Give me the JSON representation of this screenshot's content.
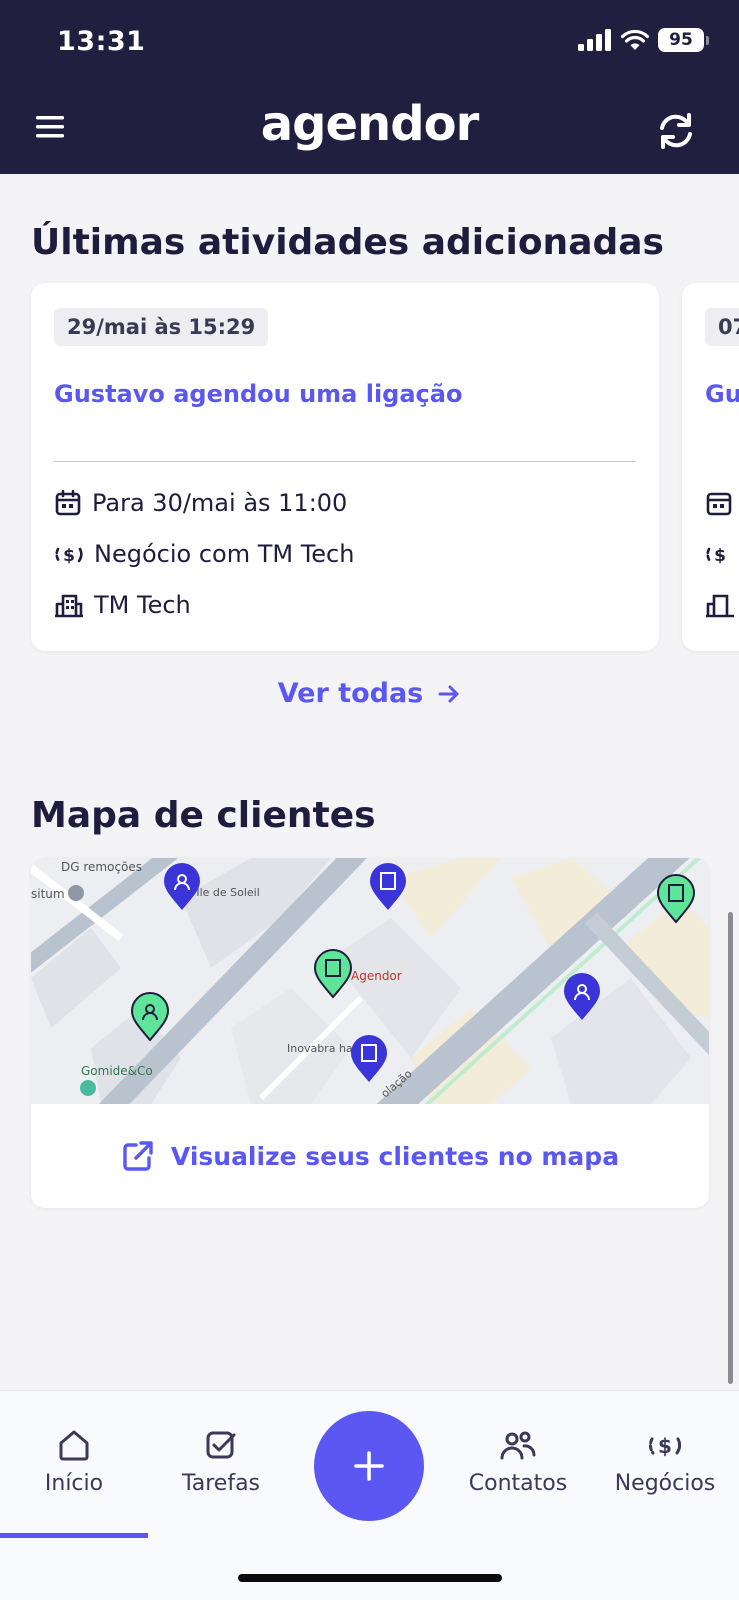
{
  "status_bar": {
    "time": "13:31",
    "battery": "95"
  },
  "header": {
    "logo": "agendor"
  },
  "activities": {
    "title": "Últimas atividades adicionadas",
    "cards": [
      {
        "date": "29/mai às 15:29",
        "title": "Gustavo agendou uma ligação",
        "schedule": "Para 30/mai às 11:00",
        "deal": "Negócio com TM Tech",
        "company": "TM Tech"
      },
      {
        "date": "07",
        "title": "Gu"
      }
    ],
    "see_all": "Ver todas"
  },
  "client_map": {
    "title": "Mapa de clientes",
    "map_labels": [
      "DG remoções",
      "situm",
      "cio Ile de Soleil",
      "Agendor",
      "Gomide&Co",
      "Inovabra ha",
      "olação",
      "P"
    ],
    "link": "Visualize seus clientes no mapa"
  },
  "bottom_nav": {
    "items": [
      {
        "label": "Início",
        "icon": "home-icon",
        "active": true
      },
      {
        "label": "Tarefas",
        "icon": "check-square-icon"
      },
      {
        "label": "Contatos",
        "icon": "contacts-icon"
      },
      {
        "label": "Negócios",
        "icon": "money-icon"
      }
    ]
  },
  "colors": {
    "primary": "#5b57f2",
    "header": "#201f3f",
    "pin_blue": "#3a35d8",
    "pin_green": "#5ee59a"
  }
}
